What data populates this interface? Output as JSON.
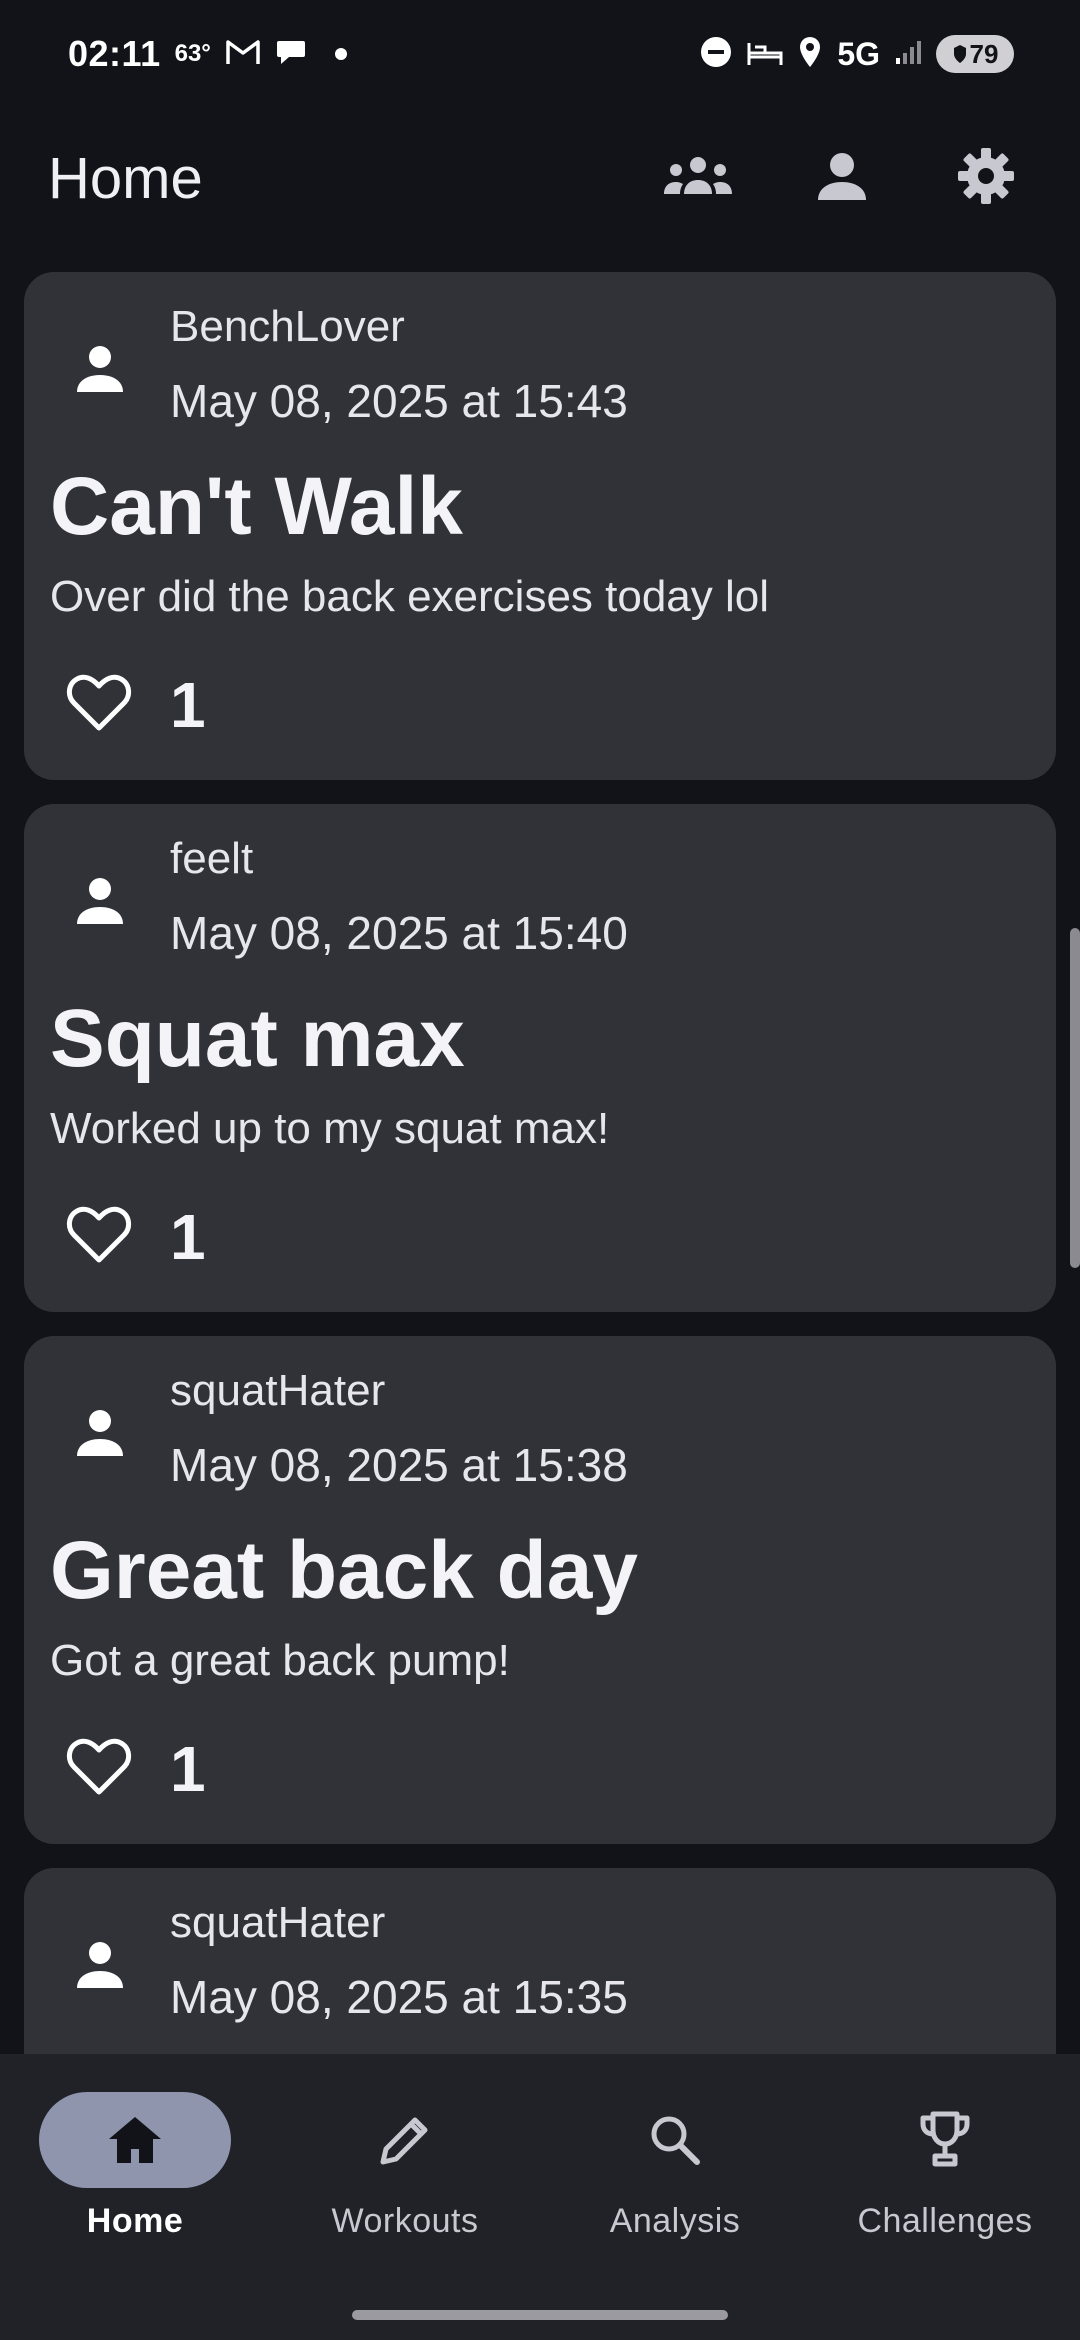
{
  "status_bar": {
    "time": "02:11",
    "temperature": "63°",
    "network": "5G",
    "battery": "79"
  },
  "app_bar": {
    "title": "Home",
    "actions": [
      {
        "icon": "group-icon"
      },
      {
        "icon": "person-icon"
      },
      {
        "icon": "gear-icon"
      }
    ]
  },
  "posts": [
    {
      "username": "BenchLover",
      "date": "May 08, 2025 at 15:43",
      "title": "Can't Walk",
      "body": "Over did the back exercises today lol",
      "likes": "1"
    },
    {
      "username": "feelt",
      "date": "May 08, 2025 at 15:40",
      "title": "Squat max",
      "body": "Worked up to my squat max!",
      "likes": "1"
    },
    {
      "username": "squatHater",
      "date": "May 08, 2025 at 15:38",
      "title": "Great back day",
      "body": "Got a great back pump!",
      "likes": "1"
    },
    {
      "username": "squatHater",
      "date": "May 08, 2025 at 15:35",
      "title": "",
      "body": "",
      "likes": ""
    }
  ],
  "bottom_nav": {
    "items": [
      {
        "label": "Home",
        "icon": "home-icon",
        "active": true
      },
      {
        "label": "Workouts",
        "icon": "pencil-icon",
        "active": false
      },
      {
        "label": "Analysis",
        "icon": "search-icon",
        "active": false
      },
      {
        "label": "Challenges",
        "icon": "trophy-icon",
        "active": false
      }
    ]
  },
  "colors": {
    "background": "#111318",
    "card": "#313238",
    "nav_background": "#202228",
    "nav_active_pill": "#8e95ad"
  }
}
